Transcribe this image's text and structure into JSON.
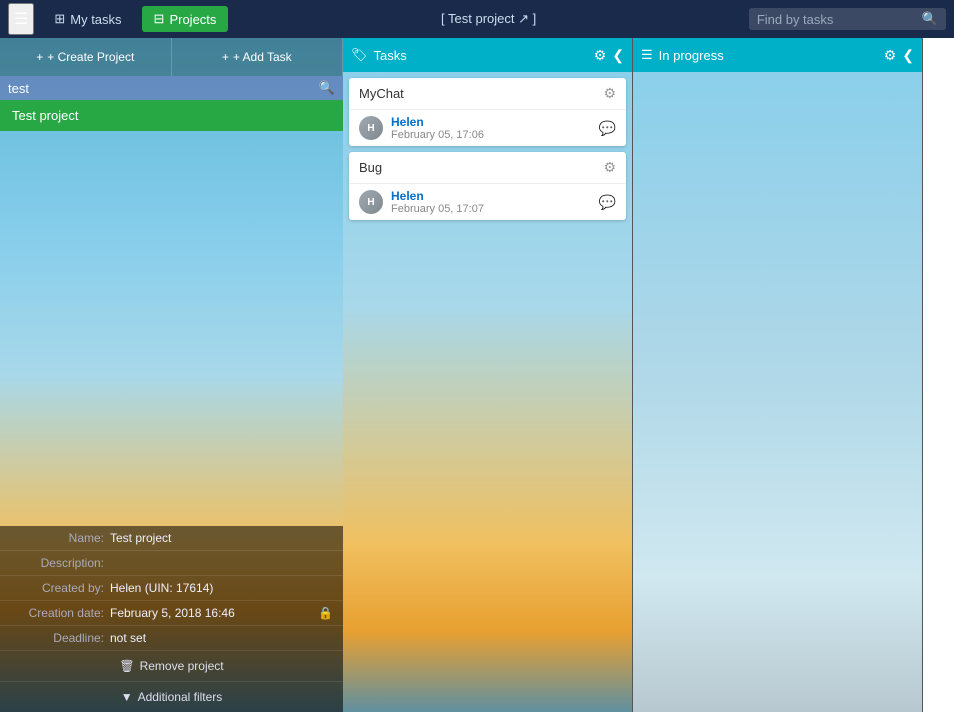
{
  "nav": {
    "hamburger": "☰",
    "my_tasks_label": "My tasks",
    "projects_label": "Projects",
    "project_title": "[ Test project ↗ ]",
    "search_placeholder": "Find by tasks"
  },
  "left_panel": {
    "create_project_label": "+ Create Project",
    "add_task_label": "+ Add Task",
    "search_placeholder": "test",
    "projects": [
      {
        "name": "Test project",
        "selected": true
      }
    ],
    "project_info": {
      "name_label": "Name:",
      "name_value": "Test project",
      "description_label": "Description:",
      "description_value": "",
      "created_by_label": "Created by:",
      "created_by_value": "Helen (UIN: 17614)",
      "creation_date_label": "Creation date:",
      "creation_date_value": "February 5, 2018 16:46",
      "deadline_label": "Deadline:",
      "deadline_value": "not set"
    },
    "remove_project_label": "Remove project",
    "additional_filters_label": "Additional filters"
  },
  "columns": [
    {
      "id": "tasks",
      "header_icon": "bookmark",
      "title": "Tasks",
      "tasks": [
        {
          "id": "mychat",
          "title": "MyChat",
          "user_name": "Helen",
          "user_date": "February 05, 17:06"
        },
        {
          "id": "bug",
          "title": "Bug",
          "user_name": "Helen",
          "user_date": "February 05, 17:07"
        }
      ]
    },
    {
      "id": "inprogress",
      "header_icon": "board",
      "title": "In progress",
      "tasks": []
    }
  ],
  "icons": {
    "gear": "⚙",
    "chevron_left": "❮",
    "search": "🔍",
    "comment": "💬",
    "trash": "🗑",
    "filter_arrow": "▼",
    "lock": "🔒",
    "plus": "+",
    "bookmark": "🏷",
    "tasks_list": "☰"
  }
}
